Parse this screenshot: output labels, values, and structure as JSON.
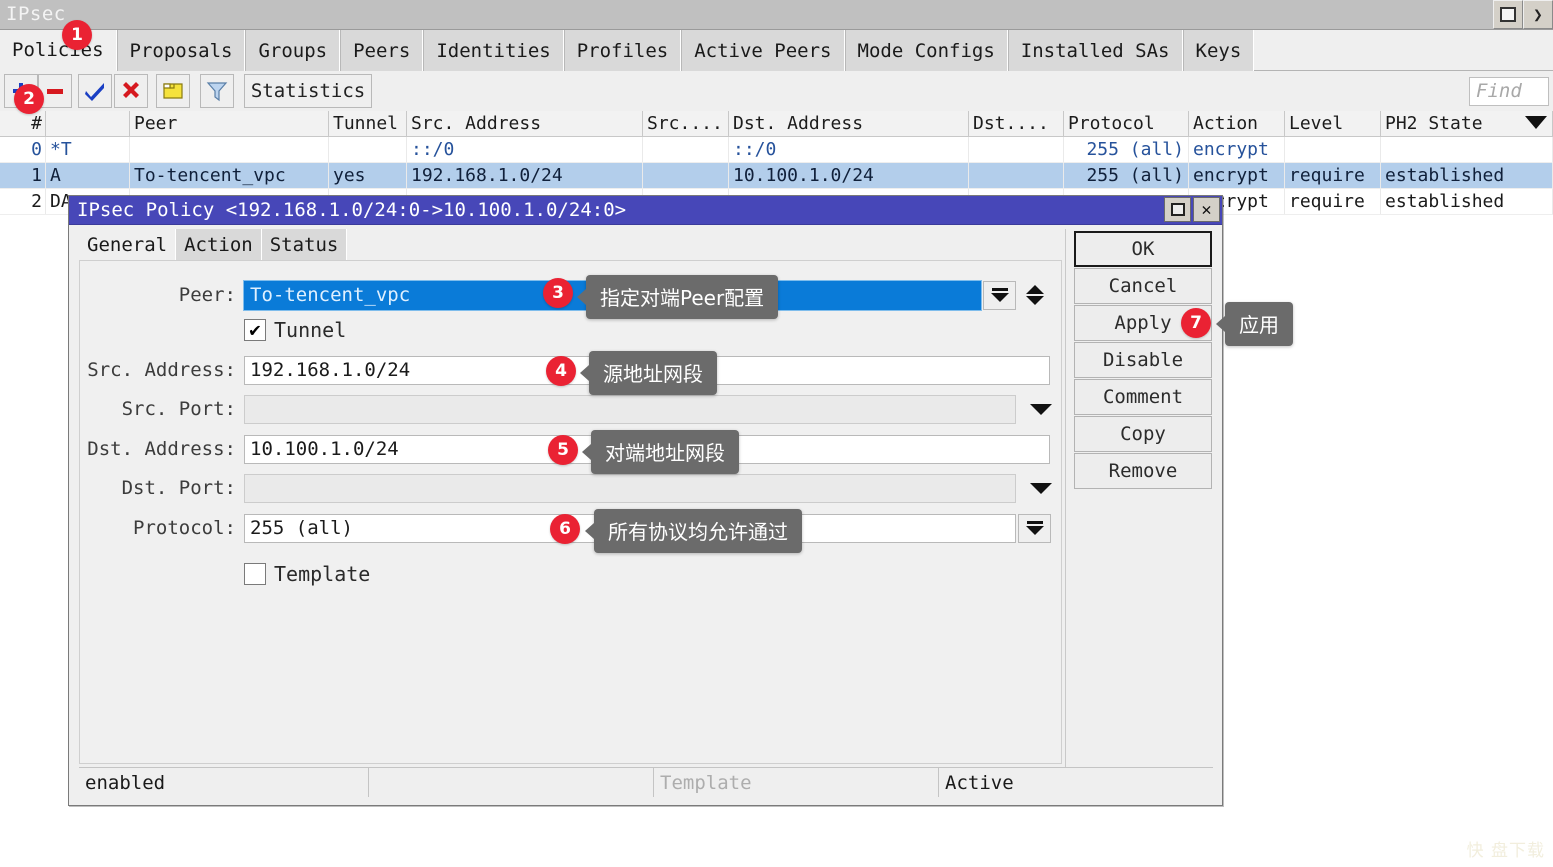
{
  "window": {
    "title": "IPsec",
    "maximize_icon": "maximize-icon",
    "next_icon": "chevron-right-icon"
  },
  "tabs": [
    {
      "label": "Policies",
      "active": true
    },
    {
      "label": "Proposals",
      "active": false
    },
    {
      "label": "Groups",
      "active": false
    },
    {
      "label": "Peers",
      "active": false
    },
    {
      "label": "Identities",
      "active": false
    },
    {
      "label": "Profiles",
      "active": false
    },
    {
      "label": "Active Peers",
      "active": false
    },
    {
      "label": "Mode Configs",
      "active": false
    },
    {
      "label": "Installed SAs",
      "active": false
    },
    {
      "label": "Keys",
      "active": false
    }
  ],
  "toolbar": {
    "add_icon": "plus-icon",
    "remove_icon": "minus-icon",
    "enable_icon": "check-icon",
    "disable_icon": "cross-icon",
    "comment_icon": "note-icon",
    "filter_icon": "funnel-icon",
    "statistics_label": "Statistics",
    "find_placeholder": "Find"
  },
  "table": {
    "columns": [
      "#",
      "",
      "Peer",
      "Tunnel",
      "Src. Address",
      "Src....",
      "Dst. Address",
      "Dst....",
      "Protocol",
      "Action",
      "Level",
      "PH2 State"
    ],
    "rows": [
      {
        "selected": false,
        "cells": [
          "0",
          "*T",
          "",
          "",
          "::/0",
          "",
          "::/0",
          "",
          "255 (all)",
          "encrypt",
          "",
          ""
        ]
      },
      {
        "selected": true,
        "cells": [
          "1",
          "A",
          "To-tencent_vpc",
          "yes",
          "192.168.1.0/24",
          "",
          "10.100.1.0/24",
          "",
          "255 (all)",
          "encrypt",
          "require",
          "established"
        ]
      },
      {
        "selected": false,
        "cells": [
          "2",
          "DA",
          "",
          "",
          "",
          "",
          "",
          "",
          "",
          "encrypt",
          "require",
          "established"
        ]
      }
    ]
  },
  "dialog": {
    "title": "IPsec Policy <192.168.1.0/24:0->10.100.1.0/24:0>",
    "restore_icon": "restore-icon",
    "close_icon": "close-icon",
    "tabs": [
      {
        "label": "General",
        "active": true
      },
      {
        "label": "Action",
        "active": false
      },
      {
        "label": "Status",
        "active": false
      }
    ],
    "fields": {
      "peer": {
        "label": "Peer:",
        "value": "To-tencent_vpc"
      },
      "tunnel": {
        "label": "Tunnel",
        "checked": true
      },
      "src_address": {
        "label": "Src. Address:",
        "value": "192.168.1.0/24"
      },
      "src_port": {
        "label": "Src. Port:",
        "value": ""
      },
      "dst_address": {
        "label": "Dst. Address:",
        "value": "10.100.1.0/24"
      },
      "dst_port": {
        "label": "Dst. Port:",
        "value": ""
      },
      "protocol": {
        "label": "Protocol:",
        "value": "255 (all)"
      },
      "template": {
        "label": "Template",
        "checked": false
      }
    },
    "buttons": [
      {
        "label": "OK",
        "primary": true
      },
      {
        "label": "Cancel",
        "primary": false
      },
      {
        "label": "Apply",
        "primary": false
      },
      {
        "label": "Disable",
        "primary": false
      },
      {
        "label": "Comment",
        "primary": false
      },
      {
        "label": "Copy",
        "primary": false
      },
      {
        "label": "Remove",
        "primary": false
      }
    ],
    "status": [
      {
        "text": "enabled",
        "muted": false
      },
      {
        "text": "",
        "muted": false
      },
      {
        "text": "Template",
        "muted": true
      },
      {
        "text": "Active",
        "muted": false
      }
    ]
  },
  "annotations": {
    "badges": [
      {
        "n": "1"
      },
      {
        "n": "2"
      },
      {
        "n": "3"
      },
      {
        "n": "4"
      },
      {
        "n": "5"
      },
      {
        "n": "6"
      },
      {
        "n": "7"
      }
    ],
    "tips": [
      {
        "text": "指定对端Peer配置"
      },
      {
        "text": "源地址网段"
      },
      {
        "text": "对端地址网段"
      },
      {
        "text": "所有协议均允许通过"
      },
      {
        "text": "应用"
      }
    ],
    "badge_color": "#ea2233",
    "tip_color": "#6b6b6b"
  },
  "watermark": {
    "text": "快 盘下载"
  }
}
